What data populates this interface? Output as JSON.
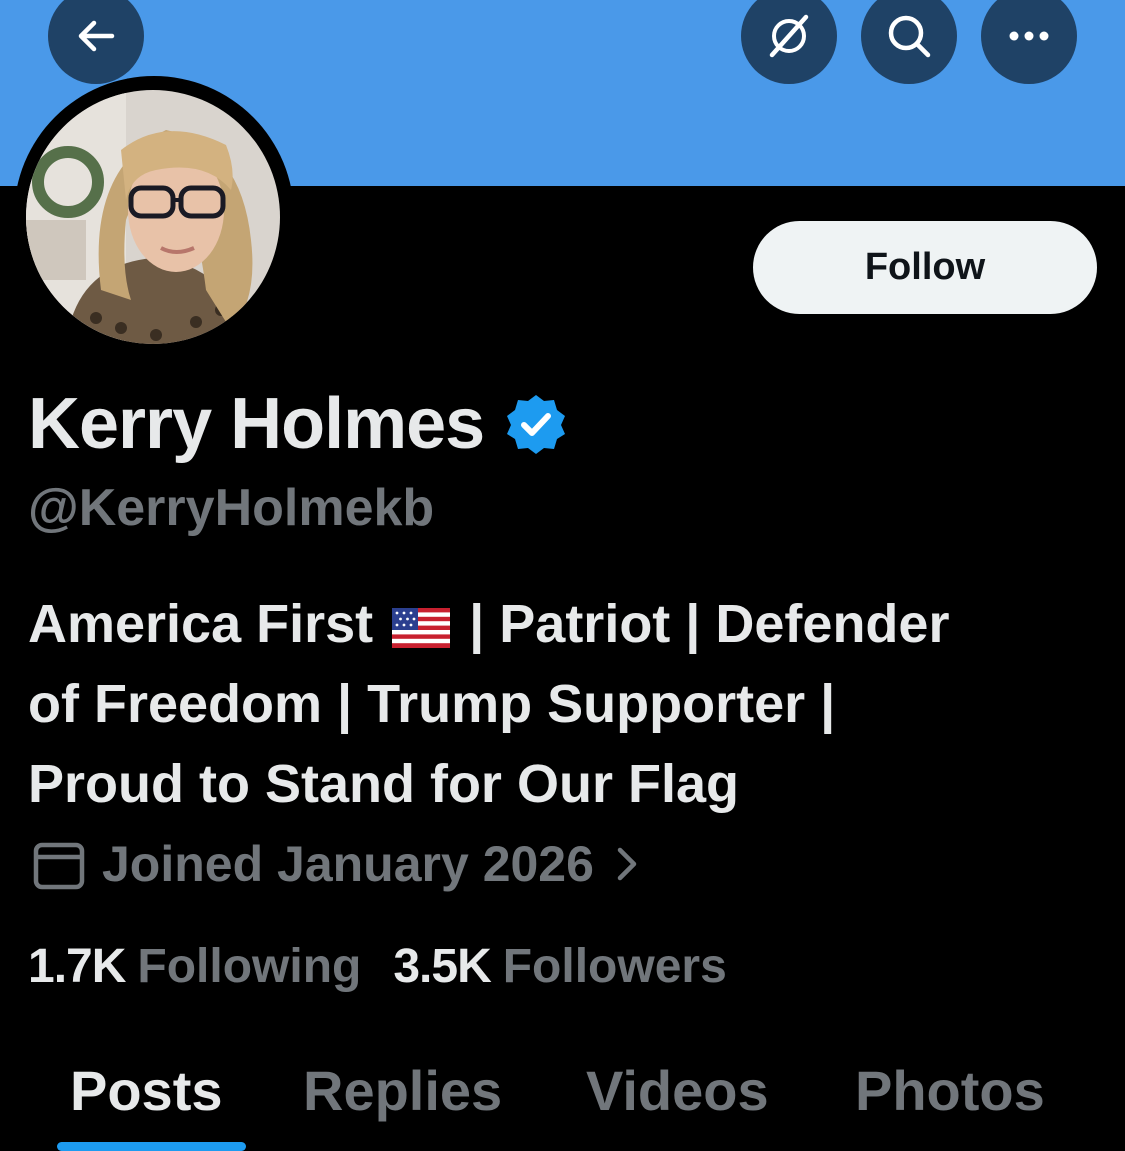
{
  "header": {
    "back_icon": "arrow-left-icon",
    "grok_icon": "grok-icon",
    "search_icon": "search-icon",
    "more_icon": "more-horizontal-icon",
    "banner_color": "#4a99e9"
  },
  "profile": {
    "display_name": "Kerry Holmes",
    "handle": "@KerryHolmekb",
    "verified_icon": "verified-badge-icon",
    "verified_color": "#1d9bf0",
    "bio_lines": [
      [
        "America First ",
        " | Patriot | Defender"
      ],
      "of Freedom | Trump Supporter |",
      "Proud to Stand for Our Flag"
    ],
    "bio_flag": "us-flag-emoji",
    "joined": "Joined January 2026",
    "calendar_icon": "calendar-icon",
    "chevron_icon": "chevron-right-icon",
    "following_count": "1.7K",
    "following_label": "Following",
    "followers_count": "3.5K",
    "followers_label": "Followers"
  },
  "actions": {
    "follow_label": "Follow"
  },
  "tabs": [
    {
      "label": "Posts",
      "active": true
    },
    {
      "label": "Replies",
      "active": false
    },
    {
      "label": "Videos",
      "active": false
    },
    {
      "label": "Photos",
      "active": false
    }
  ],
  "colors": {
    "background": "#000000",
    "text_primary": "#e7e9ea",
    "text_secondary": "#71767b",
    "accent": "#1d9bf0"
  }
}
